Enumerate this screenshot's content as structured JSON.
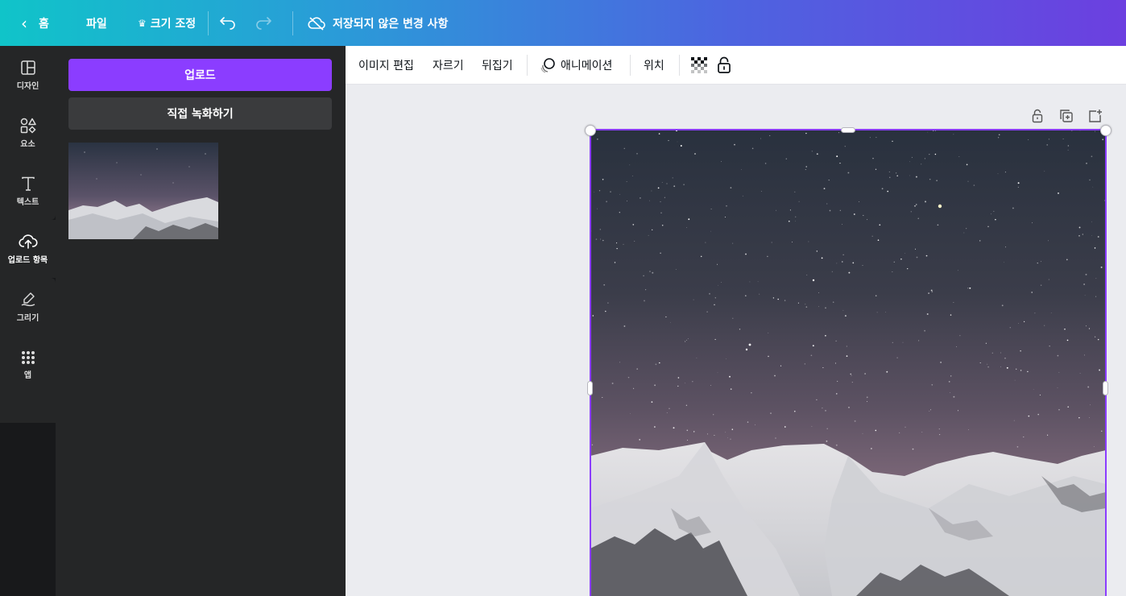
{
  "topbar": {
    "home_label": "홈",
    "file_label": "파일",
    "resize_label": "크기 조정",
    "save_status": "저장되지 않은 변경 사항",
    "gradient_colors": [
      "#10c4c9",
      "#4d64e0",
      "#6c3fe0"
    ]
  },
  "rail": {
    "items": [
      {
        "label": "디자인",
        "icon": "layout-icon"
      },
      {
        "label": "요소",
        "icon": "shapes-icon"
      },
      {
        "label": "텍스트",
        "icon": "text-icon"
      },
      {
        "label": "업로드 항목",
        "icon": "cloud-upload-icon",
        "active": true
      },
      {
        "label": "그리기",
        "icon": "draw-icon"
      },
      {
        "label": "앱",
        "icon": "apps-grid-icon"
      }
    ]
  },
  "panel": {
    "upload_label": "업로드",
    "record_label": "직접 녹화하기",
    "accent": "#8b3dff"
  },
  "context_toolbar": {
    "edit_image": "이미지 편집",
    "crop": "자르기",
    "flip": "뒤집기",
    "animate": "애니메이션",
    "position": "위치"
  }
}
